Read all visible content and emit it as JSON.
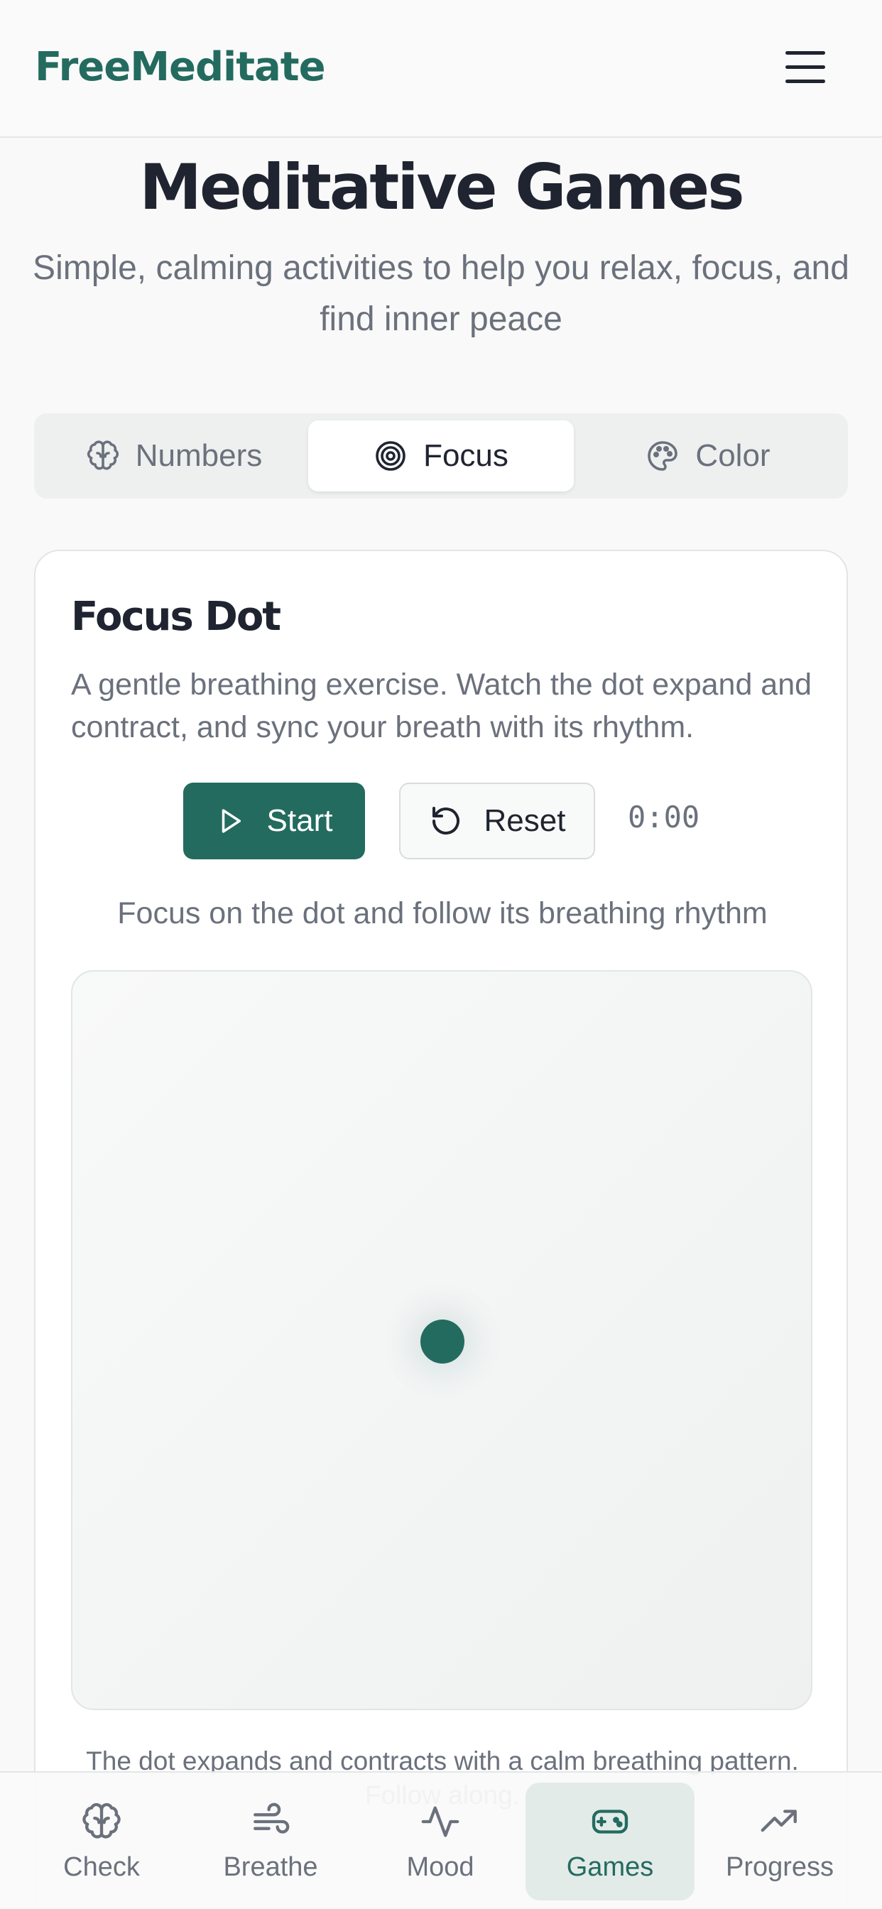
{
  "header": {
    "brand": "FreeMeditate",
    "menu_icon": "hamburger-menu-icon"
  },
  "page": {
    "title": "Meditative Games",
    "subtitle": "Simple, calming activities to help you relax, focus, and find inner peace"
  },
  "tabs": [
    {
      "label": "Numbers",
      "icon": "brain-icon",
      "active": false
    },
    {
      "label": "Focus",
      "icon": "target-icon",
      "active": true
    },
    {
      "label": "Color",
      "icon": "palette-icon",
      "active": false
    }
  ],
  "game": {
    "title": "Focus Dot",
    "description": "A gentle breathing exercise. Watch the dot expand and contract, and sync your breath with its rhythm.",
    "start_label": "Start",
    "reset_label": "Reset",
    "timer": "0:00",
    "instruction": "Focus on the dot and follow its breathing rhythm",
    "footer": "The dot expands and contracts with a calm breathing pattern. Follow along."
  },
  "bottom_nav": [
    {
      "label": "Check",
      "icon": "brain-icon",
      "active": false
    },
    {
      "label": "Breathe",
      "icon": "wind-icon",
      "active": false
    },
    {
      "label": "Mood",
      "icon": "activity-icon",
      "active": false
    },
    {
      "label": "Games",
      "icon": "gamepad-icon",
      "active": true
    },
    {
      "label": "Progress",
      "icon": "trending-up-icon",
      "active": false
    }
  ],
  "colors": {
    "accent": "#246b5f",
    "text": "#1f2430",
    "muted": "#6b717c",
    "background": "#f9f9f9"
  }
}
